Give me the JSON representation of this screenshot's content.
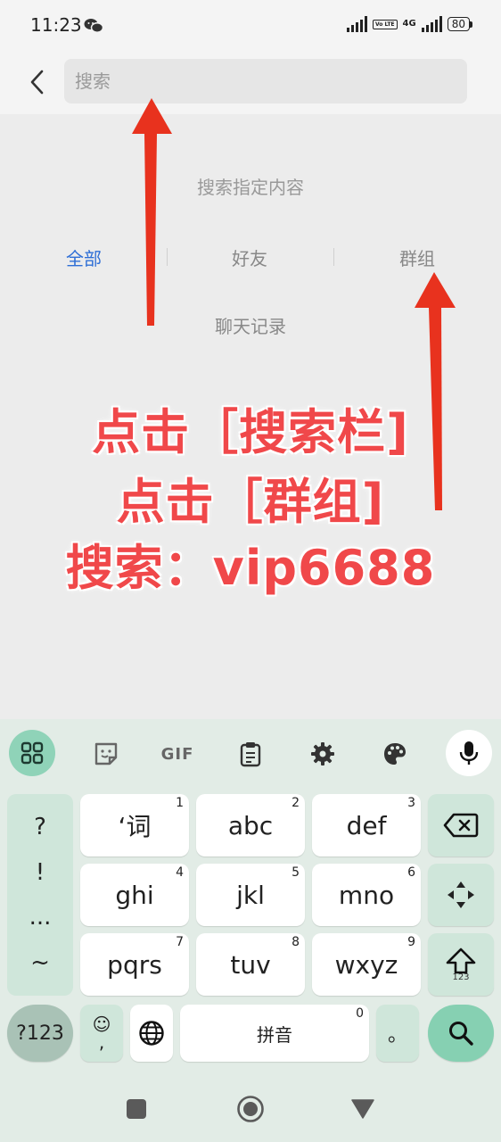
{
  "status_bar": {
    "time": "11:23",
    "battery": "80",
    "network": "4G",
    "volte": "Vo LTE"
  },
  "search": {
    "placeholder": "搜索"
  },
  "filters": {
    "hint": "搜索指定内容",
    "items": [
      "全部",
      "好友",
      "群组",
      "聊天记录"
    ],
    "active_color": "#2f6fd6"
  },
  "overlay": {
    "lines": [
      "点击［搜索栏]",
      "点击［群组]",
      "搜索：vip6688"
    ],
    "color": "#f0484a",
    "arrow_color": "#e8321e"
  },
  "keyboard": {
    "toolbar": {
      "gif": "GIF"
    },
    "punctuation": [
      "?",
      "!",
      "...",
      "~"
    ],
    "keys": [
      {
        "label": "‘词",
        "num": "1"
      },
      {
        "label": "abc",
        "num": "2"
      },
      {
        "label": "def",
        "num": "3"
      },
      {
        "label": "ghi",
        "num": "4"
      },
      {
        "label": "jkl",
        "num": "5"
      },
      {
        "label": "mno",
        "num": "6"
      },
      {
        "label": "pqrs",
        "num": "7"
      },
      {
        "label": "tuv",
        "num": "8"
      },
      {
        "label": "wxyz",
        "num": "9"
      }
    ],
    "shift_sub": "123",
    "mode_key": "?123",
    "emoji_key": [
      "☺",
      ","
    ],
    "space_label": "拼音",
    "space_num": "0",
    "period": "。",
    "accent": "#86d0b2"
  }
}
